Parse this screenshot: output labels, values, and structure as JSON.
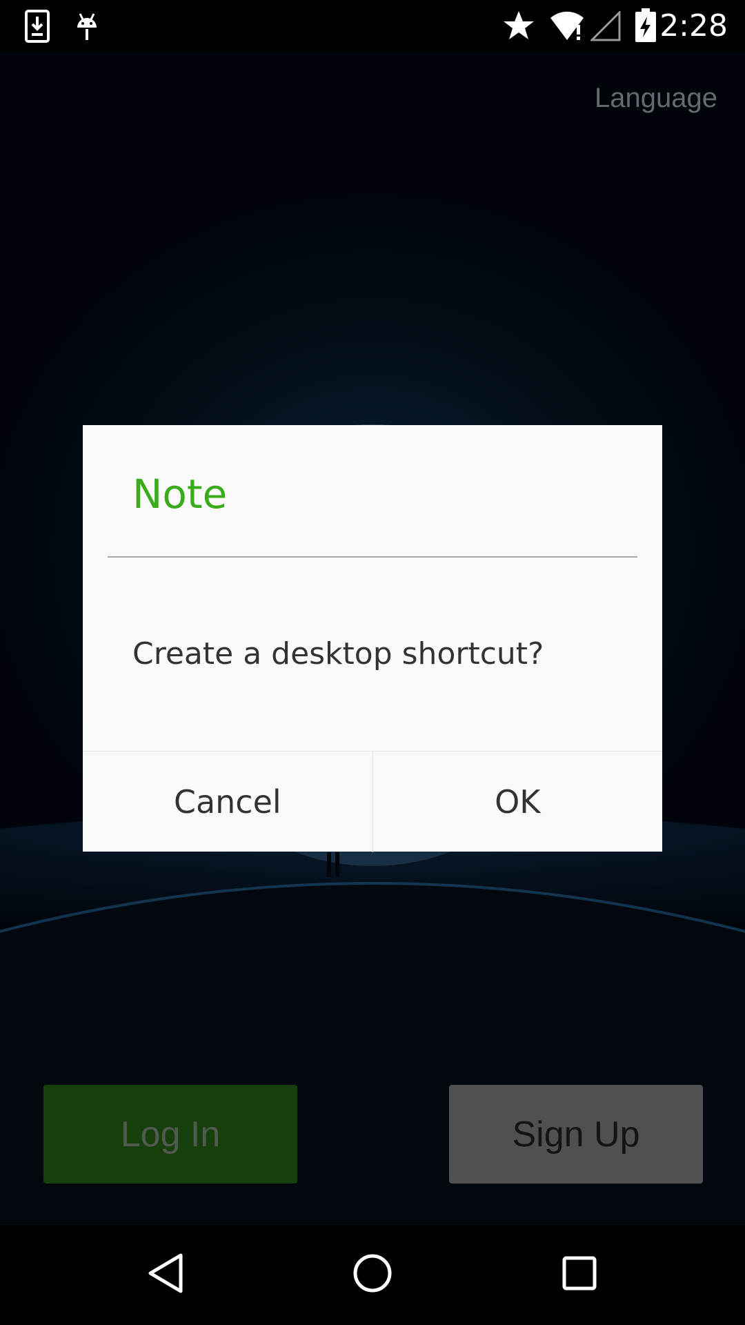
{
  "status_bar": {
    "time": "2:28",
    "left_icons": [
      "download-icon",
      "android-debug-icon"
    ],
    "right_icons": [
      "star-icon",
      "wifi-alert-icon",
      "cell-signal-icon",
      "battery-charging-icon"
    ]
  },
  "header": {
    "language_label": "Language"
  },
  "dialog": {
    "title": "Note",
    "message": "Create a desktop shortcut?",
    "cancel_label": "Cancel",
    "ok_label": "OK",
    "title_color": "#3aab1a"
  },
  "actions": {
    "login_label": "Log In",
    "signup_label": "Sign Up",
    "login_color": "#246112",
    "signup_color": "#7b7b7b"
  },
  "nav_bar": {
    "icons": [
      "back-icon",
      "home-icon",
      "recents-icon"
    ]
  }
}
